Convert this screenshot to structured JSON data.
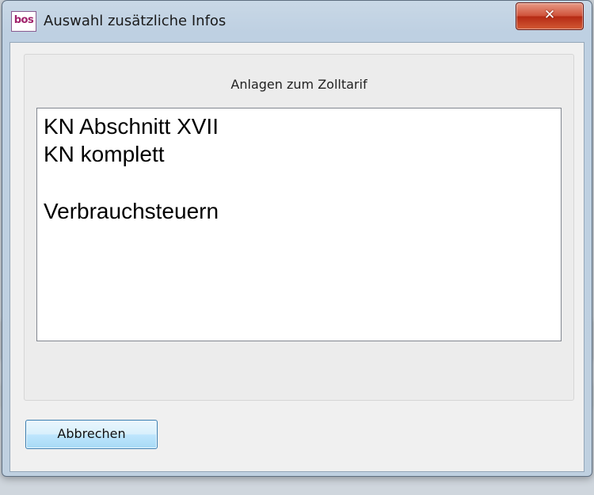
{
  "window": {
    "app_icon_text": "bos",
    "title": "Auswahl zusätzliche Infos",
    "close_label": "✕"
  },
  "group": {
    "label": "Anlagen zum Zolltarif"
  },
  "list": {
    "items": [
      "KN Abschnitt XVII",
      "KN komplett",
      "",
      "Verbrauchsteuern"
    ]
  },
  "buttons": {
    "cancel_label": "Abbrechen"
  }
}
